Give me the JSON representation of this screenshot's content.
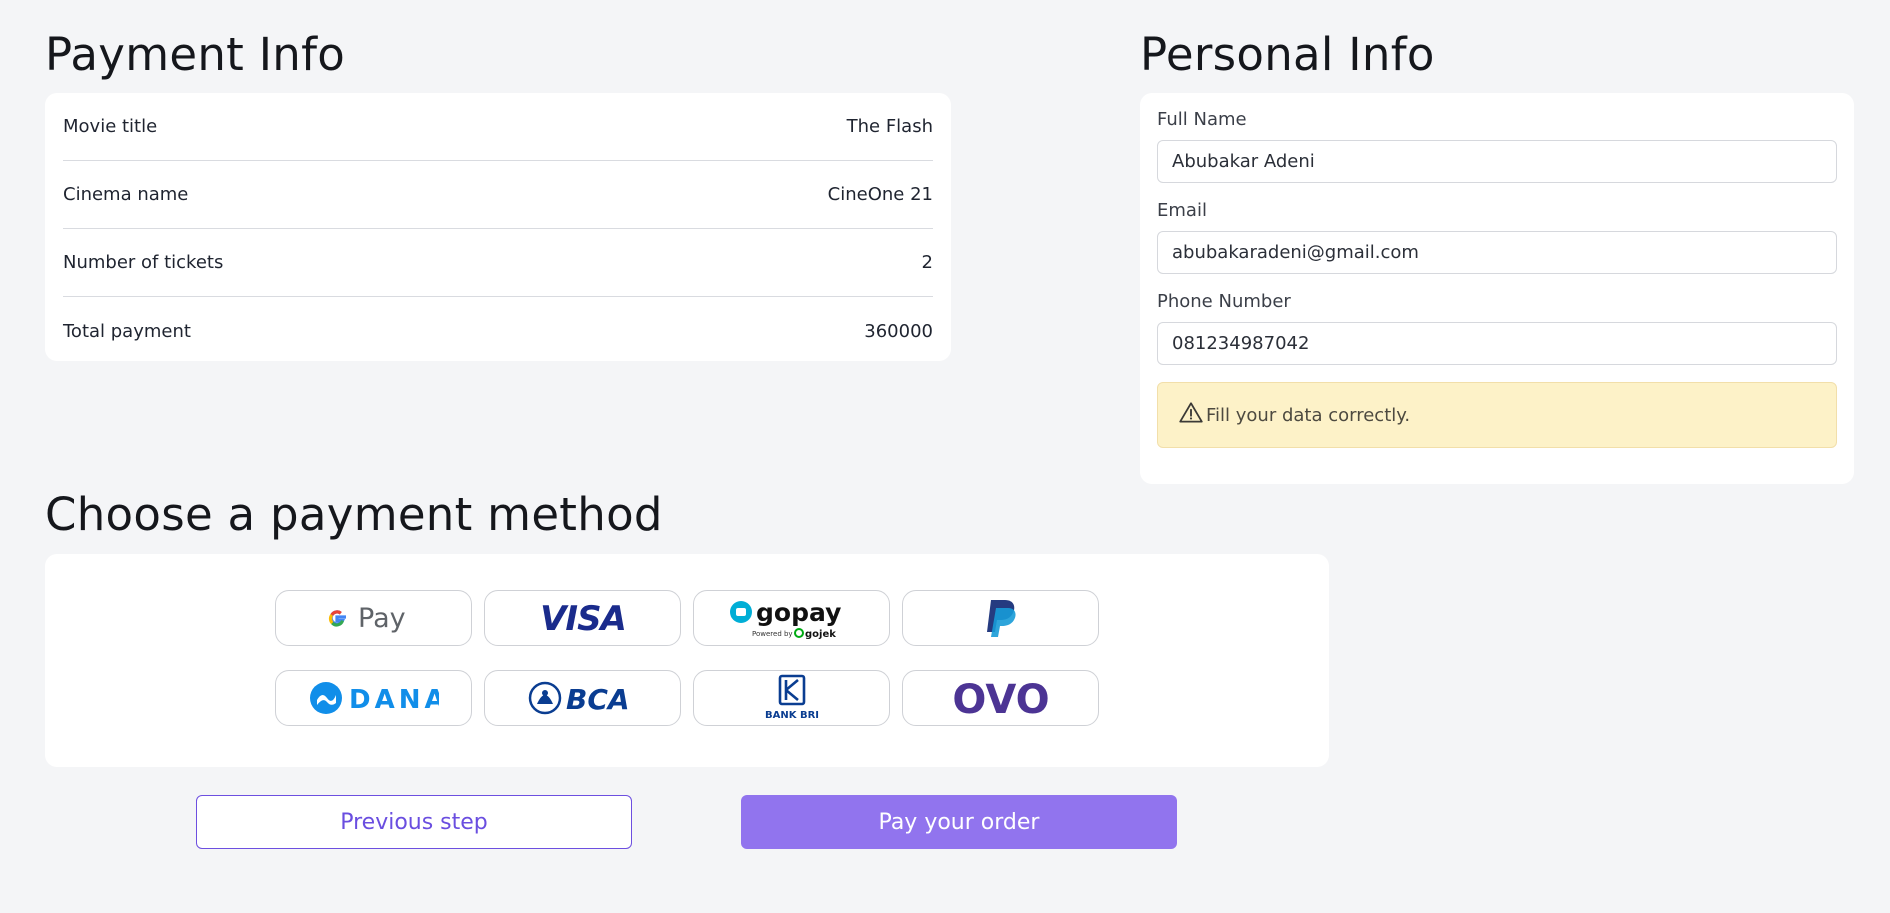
{
  "payment_info": {
    "title": "Payment Info",
    "rows": [
      {
        "label": "Movie title",
        "value": "The Flash"
      },
      {
        "label": "Cinema name",
        "value": "CineOne 21"
      },
      {
        "label": "Number of tickets",
        "value": "2"
      },
      {
        "label": "Total payment",
        "value": "360000"
      }
    ]
  },
  "personal_info": {
    "title": "Personal Info",
    "full_name_label": "Full Name",
    "full_name_value": "Abubakar Adeni",
    "email_label": "Email",
    "email_value": "abubakaradeni@gmail.com",
    "phone_label": "Phone Number",
    "phone_value": "081234987042",
    "alert_text": "Fill your data correctly.",
    "alert_icon": "warning-triangle-icon"
  },
  "payment_methods": {
    "title": "Choose a payment method",
    "methods": [
      {
        "name": "gpay",
        "logo_text": "G Pay"
      },
      {
        "name": "visa",
        "logo_text": "VISA"
      },
      {
        "name": "gopay",
        "logo_text": "gopay",
        "logo_subtext": "Powered by gojek"
      },
      {
        "name": "paypal",
        "logo_text": "PayPal"
      },
      {
        "name": "dana",
        "logo_text": "DANA"
      },
      {
        "name": "bca",
        "logo_text": "BCA"
      },
      {
        "name": "bri",
        "logo_text": "BANK BRI"
      },
      {
        "name": "ovo",
        "logo_text": "OVO"
      }
    ]
  },
  "actions": {
    "previous_label": "Previous step",
    "pay_label": "Pay your order"
  },
  "colors": {
    "background": "#f4f5f7",
    "accent": "#9174ee",
    "accent_border": "#6d4fe0",
    "alert_bg": "#fdf2c8"
  }
}
